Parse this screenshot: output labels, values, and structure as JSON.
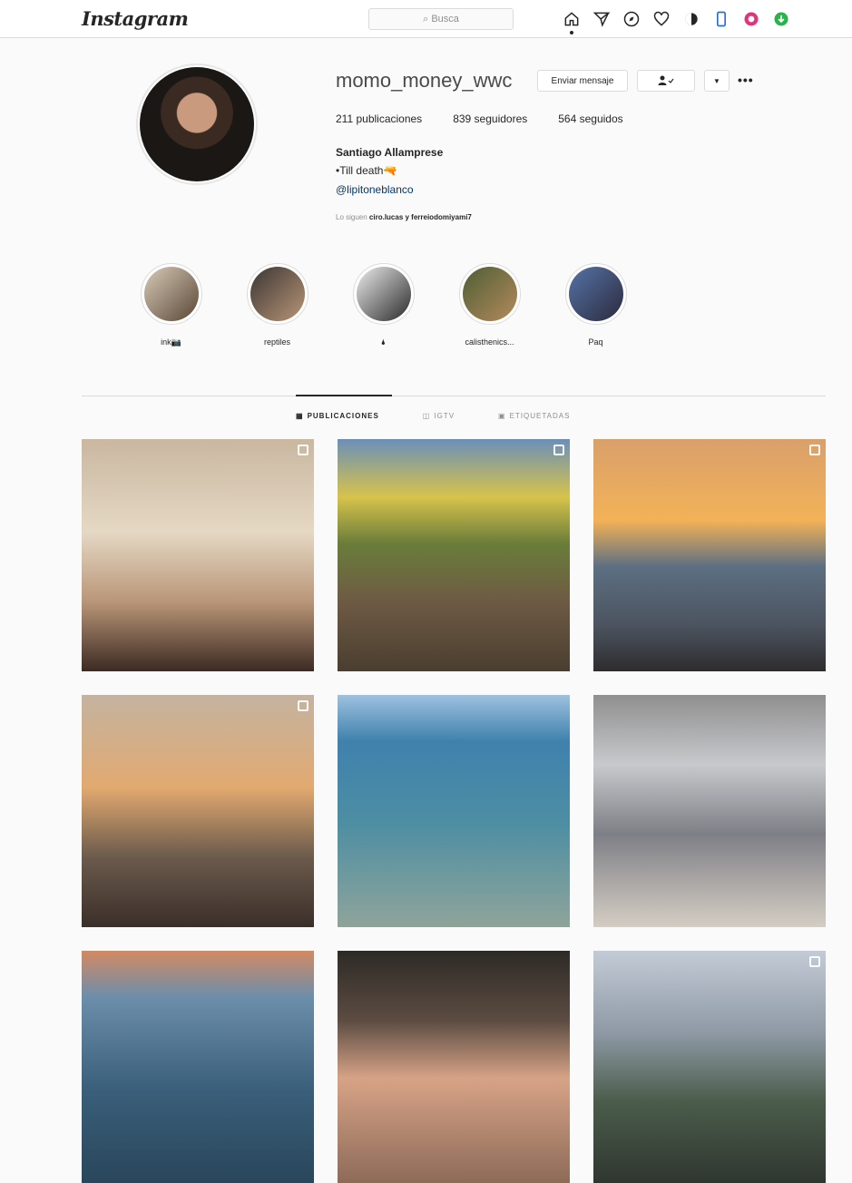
{
  "nav": {
    "logo": "Instagram",
    "search_placeholder": "Busca",
    "icons": [
      "home-icon",
      "direct-icon",
      "explore-icon",
      "heart-icon",
      "contrast-extension-icon",
      "phone-extension-icon",
      "record-extension-icon",
      "download-extension-icon"
    ]
  },
  "profile": {
    "username": "momo_money_wwc",
    "message_button": "Enviar mensaje",
    "following_button_icon": "person-check-icon",
    "stats": {
      "posts": "211 publicaciones",
      "followers": "839 seguidores",
      "following": "564 seguidos"
    },
    "full_name": "Santiago Allamprese",
    "bio": "•Till death🔫",
    "link": "@lipitoneblanco",
    "followed_by_prefix": "Lo siguen ",
    "followed_by_names": "ciro.lucas y ferreiodomiyami7"
  },
  "highlights": [
    {
      "label": "ink📷",
      "colors": [
        "#d8cbb8",
        "#5a4636"
      ]
    },
    {
      "label": "reptiles",
      "colors": [
        "#3b3634",
        "#b99577"
      ]
    },
    {
      "label": "🌢",
      "colors": [
        "#ececec",
        "#2a2a2a"
      ]
    },
    {
      "label": "calisthenics...",
      "colors": [
        "#4f5e35",
        "#b38a5c"
      ]
    },
    {
      "label": "Paq",
      "colors": [
        "#5573a6",
        "#2c2a3d"
      ]
    }
  ],
  "tabs": [
    {
      "label": "PUBLICACIONES",
      "icon": "grid-icon",
      "active": true
    },
    {
      "label": "IGTV",
      "icon": "igtv-icon",
      "active": false
    },
    {
      "label": "ETIQUETADAS",
      "icon": "tag-icon",
      "active": false
    }
  ],
  "posts": [
    {
      "name": "post-living-room",
      "multi": true,
      "bg": "linear-gradient(180deg,#c9b7a0 0%,#e5d8c4 40%,#b99678 70%,#3c2a22 100%)"
    },
    {
      "name": "post-tire-flip",
      "multi": true,
      "bg": "linear-gradient(180deg,#6b8fb8 0%,#d7c34b 25%,#6a7d3a 45%,#6e5a44 70%,#4a3e30 100%)"
    },
    {
      "name": "post-sunset-beach",
      "multi": true,
      "bg": "linear-gradient(180deg,#d9a06b 0%,#f3b257 35%,#5c6f82 55%,#4c5460 80%,#2e2c2e 100%)"
    },
    {
      "name": "post-rocks-sunset",
      "multi": true,
      "bg": "linear-gradient(180deg,#c4b3a0 0%,#e2a970 40%,#6b5a4c 70%,#3b2f2a 100%)"
    },
    {
      "name": "post-sea-swim",
      "multi": false,
      "bg": "linear-gradient(180deg,#9ec1df 0%,#3f81ad 20%,#4d8ea3 55%,#8fa49a 100%)"
    },
    {
      "name": "post-cafe-table",
      "multi": false,
      "bg": "linear-gradient(180deg,#8f8f8f 0%,#c8c9cc 30%,#7e7f86 60%,#d4cdc3 100%)"
    },
    {
      "name": "post-sea-dusk",
      "multi": false,
      "bg": "linear-gradient(180deg,#d28a62 0%,#6c8eab 20%,#3a5f7a 60%,#29465b 100%)"
    },
    {
      "name": "post-selfie-car",
      "multi": false,
      "bg": "linear-gradient(180deg,#2d2a26 0%,#5c4c42 30%,#d7a387 55%,#8d6b58 100%)"
    },
    {
      "name": "post-hikers-group",
      "multi": true,
      "bg": "linear-gradient(180deg,#c3cbd6 0%,#8f9aa6 35%,#4b5c4b 65%,#2f3630 100%)"
    }
  ]
}
